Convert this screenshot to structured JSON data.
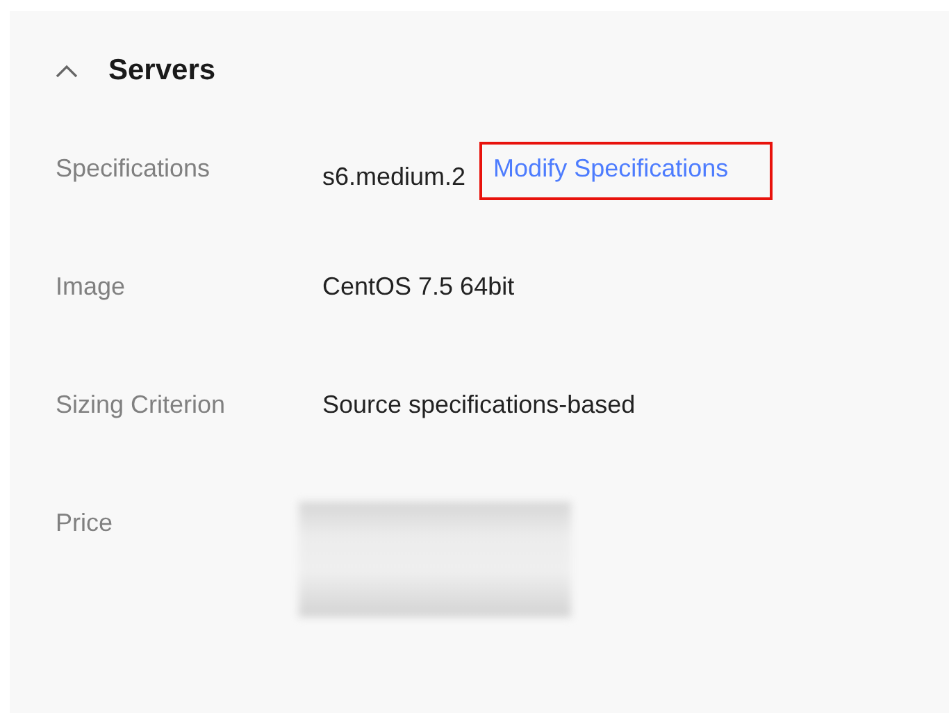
{
  "section": {
    "title": "Servers",
    "expanded": true,
    "rows": [
      {
        "label": "Specifications",
        "values": [
          {
            "kind": "text",
            "text": "s6.medium.2"
          },
          {
            "kind": "link",
            "text": "Modify Specifications",
            "highlighted": true
          }
        ]
      },
      {
        "label": "Image",
        "values": [
          {
            "kind": "text",
            "text": "CentOS 7.5 64bit"
          }
        ]
      },
      {
        "label": "Sizing Criterion",
        "values": [
          {
            "kind": "text",
            "text": "Source specifications-based"
          }
        ]
      },
      {
        "label": "Price",
        "values": [
          {
            "kind": "redacted"
          }
        ]
      }
    ]
  }
}
